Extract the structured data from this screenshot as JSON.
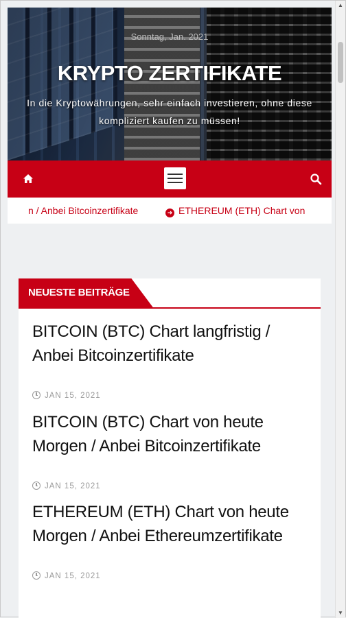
{
  "header": {
    "date_line": "Sonntag, Jan. 2021",
    "site_title": "KRYPTO ZERTIFIKATE",
    "tagline": "In die Kryptowährungen, sehr einfach investieren, ohne diese kompliziert kaufen zu müssen!"
  },
  "navbar": {
    "home_icon": "home-icon",
    "menu_icon": "hamburger-menu-icon",
    "search_icon": "search-icon"
  },
  "ticker": {
    "items": [
      "n / Anbei Bitcoinzertifikate",
      "ETHEREUM (ETH) Chart von"
    ]
  },
  "widget": {
    "title": "Neueste Beiträge",
    "posts": [
      {
        "title": "BITCOIN (BTC) Chart langfristig / Anbei Bitcoinzertifikate",
        "date": "JAN 15, 2021"
      },
      {
        "title": "BITCOIN (BTC) Chart von heute Morgen / Anbei Bitcoinzertifikate",
        "date": "JAN 15, 2021"
      },
      {
        "title": "ETHEREUM (ETH) Chart von heute Morgen / Anbei Ethereumzertifikate",
        "date": "JAN 15, 2021"
      }
    ]
  },
  "colors": {
    "brand_red": "#c70015",
    "text_dark": "#111111",
    "meta_gray": "#999999"
  }
}
